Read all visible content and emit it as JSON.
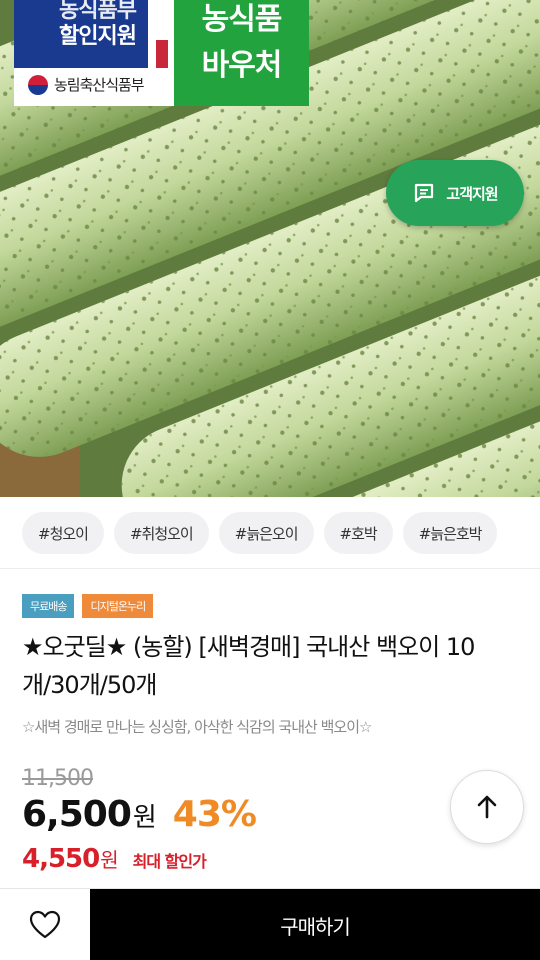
{
  "hero": {
    "badge_blue_line1": "농식품부",
    "badge_blue_line2": "할인지원",
    "ministry": "농림축산식품부",
    "badge_green_line1": "농식품",
    "badge_green_line2": "바우처",
    "customer_support": "고객지원",
    "customer_support_icon": "chat-bubble-icon"
  },
  "tags": [
    "#청오이",
    "#취청오이",
    "#늙은오이",
    "#호박",
    "#늙은호박"
  ],
  "chips": {
    "free_shipping": "무료배송",
    "digital_voucher": "디지털온누리"
  },
  "product": {
    "title": "★오굿딜★ (농할) [새벽경매] 국내산 백오이 10개/30개/50개",
    "subtitle": "☆새벽 경매로 만나는 싱싱함, 아삭한 식감의 국내산 백오이☆",
    "original_price": "11,500",
    "price": "6,500",
    "currency": "원",
    "discount": "43%",
    "max_discount_price": "4,550",
    "max_discount_label": "최대 할인가"
  },
  "bottom_bar": {
    "wishlist_icon": "heart-icon",
    "buy_label": "구매하기"
  },
  "icons": {
    "scroll_top": "arrow-up-icon"
  },
  "colors": {
    "support_green": "#27a35a",
    "discount_orange": "#f08a24",
    "max_price_red": "#d8202b",
    "buy_black": "#000000",
    "chip_blue": "#4a9ebf",
    "chip_orange": "#ef8a3b"
  }
}
